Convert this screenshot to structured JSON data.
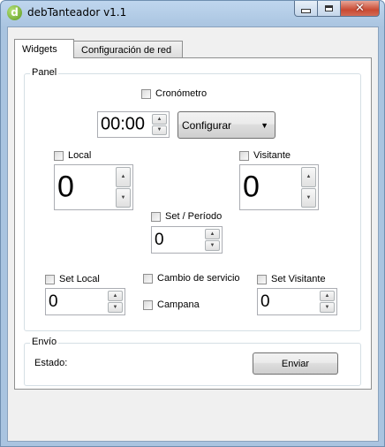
{
  "window": {
    "title": "debTanteador v1.1",
    "app_icon_letter": "d"
  },
  "title_buttons": {
    "minimize": "minimize",
    "maximize": "maximize",
    "close": "✕"
  },
  "tabs": [
    {
      "label": "Widgets",
      "active": true
    },
    {
      "label": "Configuración de red",
      "active": false
    }
  ],
  "panel": {
    "title": "Panel",
    "cronometro": {
      "label": "Cronómetro",
      "checked": false,
      "time": "00:00"
    },
    "configurar": {
      "value": "Configurar"
    },
    "local": {
      "label": "Local",
      "checked": false,
      "value": "0"
    },
    "visitante": {
      "label": "Visitante",
      "checked": false,
      "value": "0"
    },
    "set_periodo": {
      "label": "Set / Período",
      "checked": false,
      "value": "0"
    },
    "set_local": {
      "label": "Set Local",
      "checked": false,
      "value": "0"
    },
    "set_visitante": {
      "label": "Set Visitante",
      "checked": false,
      "value": "0"
    },
    "cambio_servicio": {
      "label": "Cambio de servicio",
      "checked": false
    },
    "campana": {
      "label": "Campana",
      "checked": false
    }
  },
  "envio": {
    "title": "Envío",
    "estado_label": "Estado:",
    "estado_value": "",
    "button": "Enviar"
  },
  "icons": {
    "spin_up": "▲",
    "spin_down": "▼",
    "combo_arrow": "▼"
  }
}
